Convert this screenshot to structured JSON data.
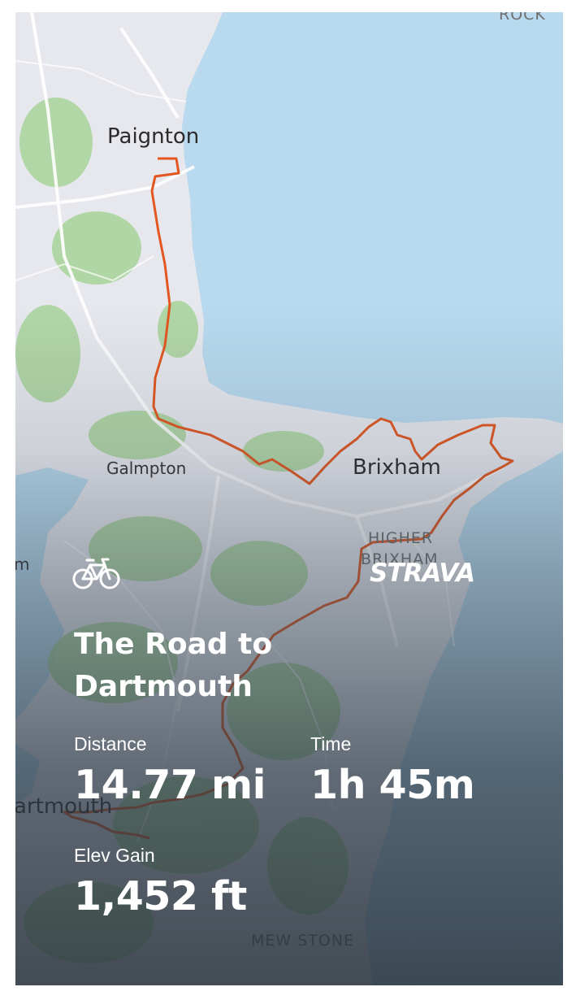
{
  "activity": {
    "title": "The Road to Dartmouth",
    "type_icon": "bike-icon"
  },
  "brand": {
    "logo_text": "STRAVA"
  },
  "stats": {
    "distance_label": "Distance",
    "distance_value": "14.77 mi",
    "time_label": "Time",
    "time_value": "1h 45m",
    "elev_label": "Elev Gain",
    "elev_value": "1,452 ft"
  },
  "map": {
    "places": {
      "paignton": "Paignton",
      "galmpton": "Galmpton",
      "brixham": "Brixham",
      "higher_brixham_1": "HIGHER",
      "higher_brixham_2": "BRIXHAM",
      "dartmouth": "artmouth",
      "mew_stone": "MEW STONE",
      "rock": "ROCK",
      "m_fragment": "m"
    },
    "colors": {
      "sea": "#b3d8ee",
      "land": "#e9eaf0",
      "green": "#a9d59a",
      "route": "#e2561f"
    }
  }
}
